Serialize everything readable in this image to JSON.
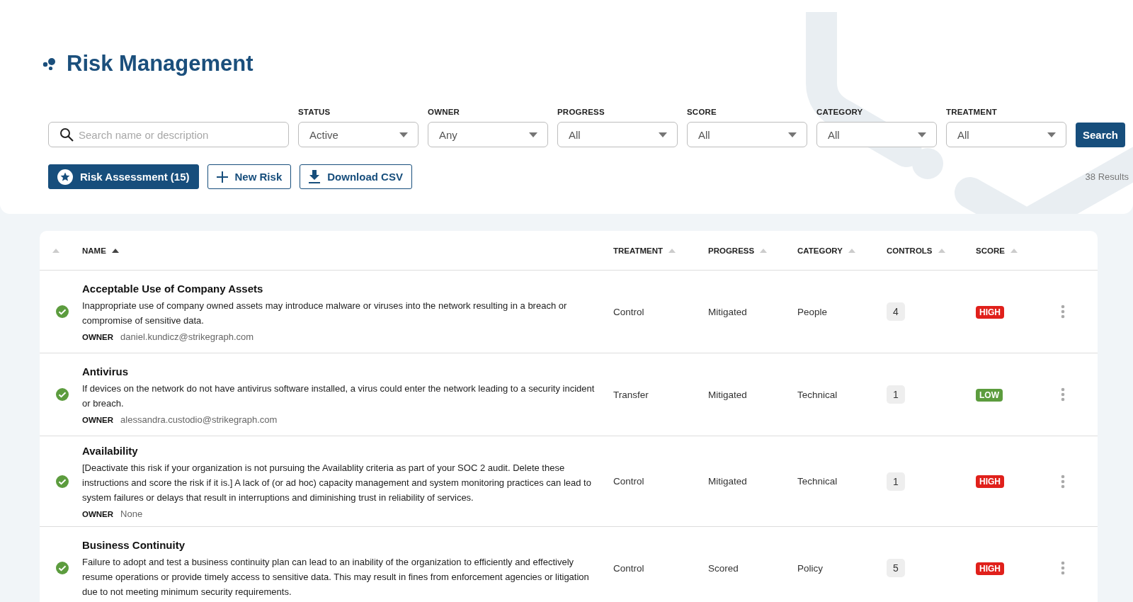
{
  "page": {
    "title": "Risk Management"
  },
  "filters": {
    "search": {
      "placeholder": "Search name or description"
    },
    "dropdowns": [
      {
        "label": "STATUS",
        "value": "Active"
      },
      {
        "label": "OWNER",
        "value": "Any"
      },
      {
        "label": "PROGRESS",
        "value": "All"
      },
      {
        "label": "SCORE",
        "value": "All"
      },
      {
        "label": "CATEGORY",
        "value": "All"
      },
      {
        "label": "TREATMENT",
        "value": "All"
      }
    ],
    "search_button": "Search"
  },
  "actions": [
    {
      "kind": "primary",
      "label": "Risk Assessment (15)"
    },
    {
      "kind": "add",
      "label": "New Risk"
    },
    {
      "kind": "download",
      "label": "Download CSV"
    }
  ],
  "results": "38 Results",
  "table": {
    "columns": [
      {
        "sorted": false
      },
      {
        "label": "NAME",
        "sorted": true
      },
      {
        "label": "TREATMENT",
        "sorted": false
      },
      {
        "label": "PROGRESS",
        "sorted": false
      },
      {
        "label": "CATEGORY",
        "sorted": false
      },
      {
        "label": "CONTROLS",
        "sorted": false
      },
      {
        "label": "SCORE",
        "sorted": false
      }
    ],
    "rows": [
      {
        "name": "Acceptable Use of Company Assets",
        "description": "Inappropriate use of company owned assets may introduce malware or viruses into the network resulting in a breach or compromise of sensitive data.",
        "owner_label": "OWNER",
        "owner": "daniel.kundicz@strikegraph.com",
        "treatment": "Control",
        "progress": "Mitigated",
        "category": "People",
        "controls": "4",
        "score": {
          "label": "HIGH",
          "color": "#e0201b"
        }
      },
      {
        "name": "Antivirus",
        "description": "If devices on the network do not have antivirus software installed, a virus could enter the network leading to a security incident or breach.",
        "owner_label": "OWNER",
        "owner": "alessandra.custodio@strikegraph.com",
        "treatment": "Transfer",
        "progress": "Mitigated",
        "category": "Technical",
        "controls": "1",
        "score": {
          "label": "LOW",
          "color": "#5c9c3e"
        }
      },
      {
        "name": "Availability",
        "description": "[Deactivate this risk if your organization is not pursuing the Availablity criteria as part of your SOC 2 audit. Delete these instructions and score the risk if it is.] A lack of (or ad hoc) capacity management and system monitoring practices can lead to system failures or delays that result in interruptions and diminishing trust in reliability of services.",
        "owner_label": "OWNER",
        "owner": "None",
        "treatment": "Control",
        "progress": "Mitigated",
        "category": "Technical",
        "controls": "1",
        "score": {
          "label": "HIGH",
          "color": "#e0201b"
        }
      },
      {
        "name": "Business Continuity",
        "description": "Failure to adopt and test a business continuity plan can lead to an inability of the organization to efficiently and effectively resume operations or provide timely access to sensitive data. This may result in fines from enforcement agencies or litigation due to not meeting minimum security requirements.",
        "treatment": "Control",
        "progress": "Scored",
        "category": "Policy",
        "controls": "5",
        "score": {
          "label": "HIGH",
          "color": "#e0201b"
        }
      }
    ]
  }
}
